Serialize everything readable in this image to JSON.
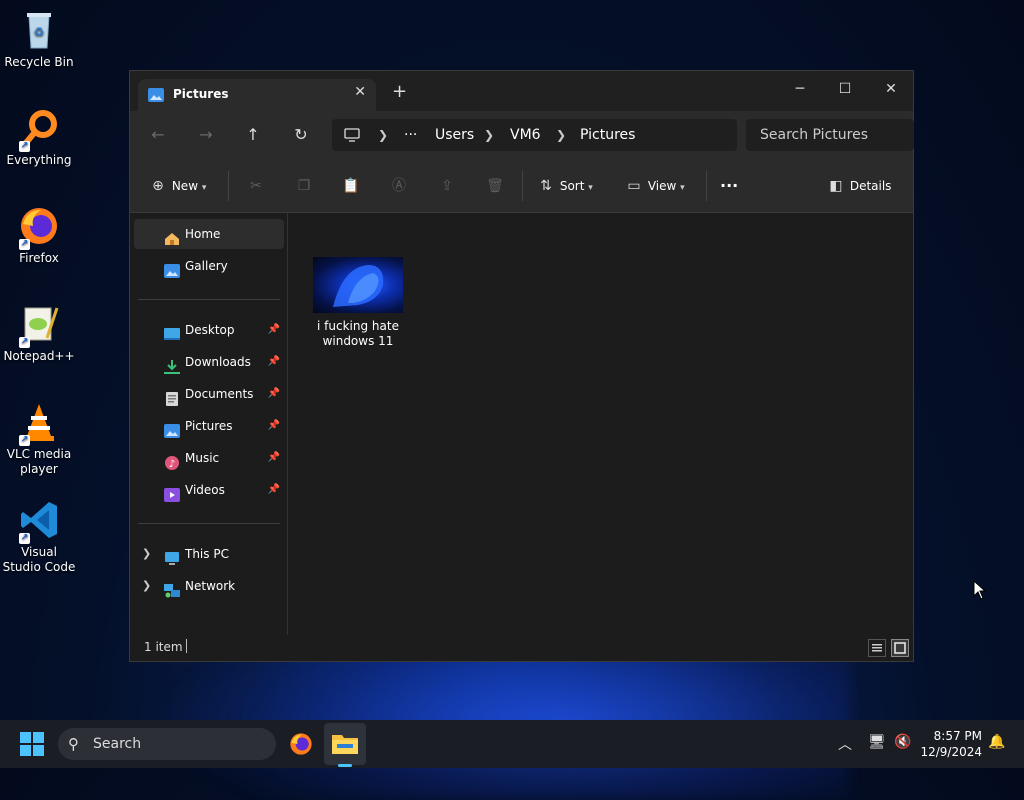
{
  "desktop": {
    "icons": [
      {
        "label": "Recycle Bin",
        "icon": "recycle-bin-icon"
      },
      {
        "label": "Everything",
        "icon": "everything-icon"
      },
      {
        "label": "Firefox",
        "icon": "firefox-icon"
      },
      {
        "label": "Notepad++",
        "icon": "notepad-plus-plus-icon"
      },
      {
        "label": "VLC media player",
        "icon": "vlc-icon"
      },
      {
        "label": "Visual Studio Code",
        "icon": "vscode-icon"
      }
    ]
  },
  "window": {
    "tab_title": "Pictures",
    "address": {
      "more": "···",
      "crumbs": [
        "Users",
        "VM6",
        "Pictures"
      ]
    },
    "search_placeholder": "Search Pictures",
    "toolbar": {
      "new_label": "New",
      "sort_label": "Sort",
      "view_label": "View",
      "more_label": "···",
      "details_label": "Details"
    },
    "nav": {
      "home": "Home",
      "gallery": "Gallery",
      "quick": [
        "Desktop",
        "Downloads",
        "Documents",
        "Pictures",
        "Music",
        "Videos"
      ],
      "this_pc": "This PC",
      "network": "Network"
    },
    "files": [
      {
        "name": "i fucking hate windows 11"
      }
    ],
    "status": "1 item"
  },
  "taskbar": {
    "search_label": "Search",
    "time": "8:57 PM",
    "date": "12/9/2024"
  },
  "colors": {
    "accent": "#4cc2ff",
    "window_bg": "#1c1c1c",
    "toolbar_bg": "#2b2b2b"
  }
}
